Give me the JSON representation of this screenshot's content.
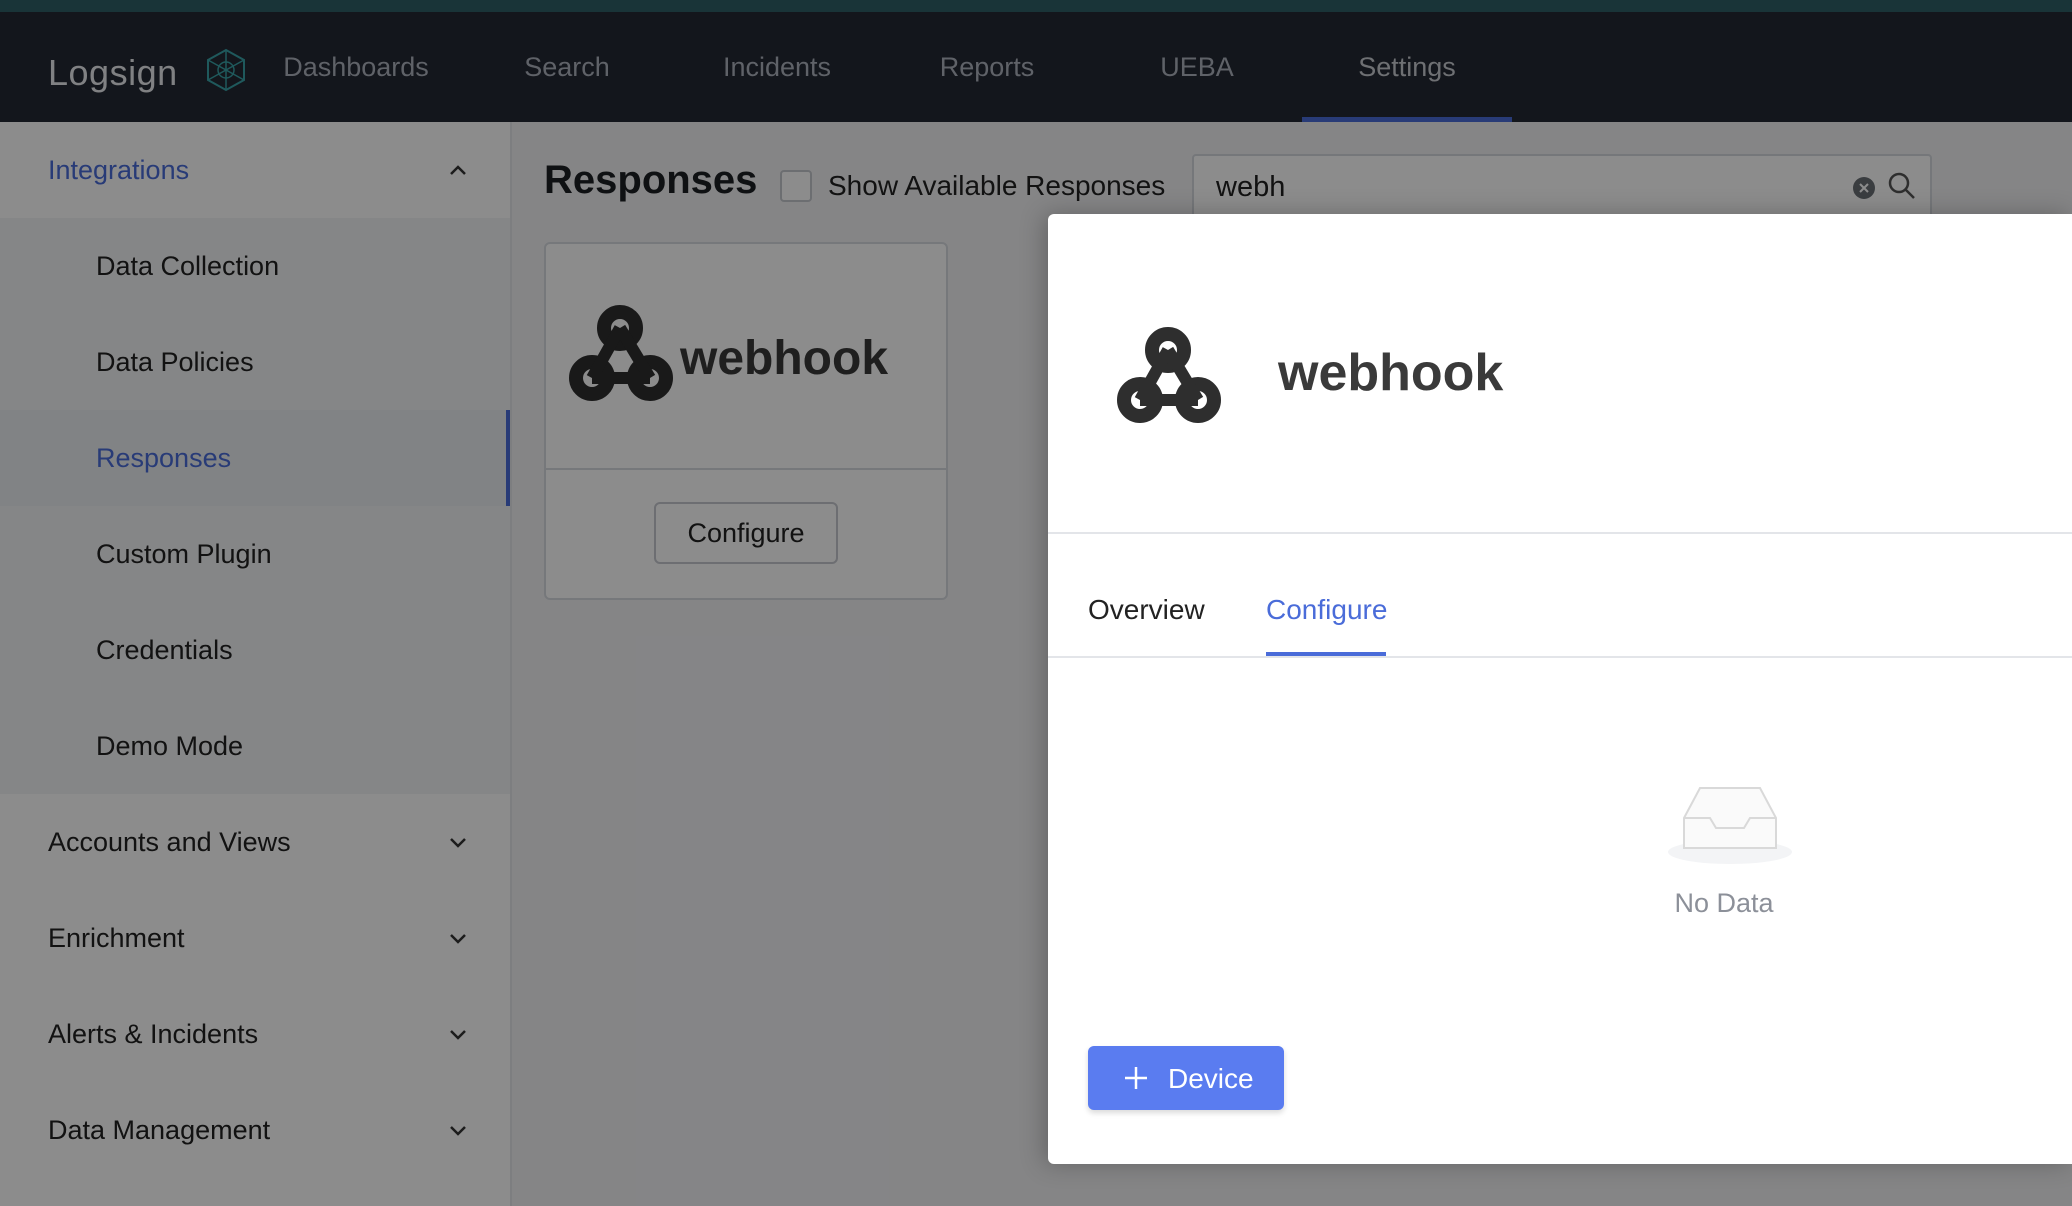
{
  "brand": {
    "logo_text": "Logsign",
    "accent": "#4a6cd9",
    "button_color": "#5a7cf0"
  },
  "nav": {
    "items": [
      {
        "label": "Dashboards"
      },
      {
        "label": "Search"
      },
      {
        "label": "Incidents"
      },
      {
        "label": "Reports"
      },
      {
        "label": "UEBA"
      },
      {
        "label": "Settings",
        "active": true
      }
    ]
  },
  "sidebar": {
    "integrations": {
      "label": "Integrations",
      "items": [
        {
          "label": "Data Collection"
        },
        {
          "label": "Data Policies"
        },
        {
          "label": "Responses",
          "active": true
        },
        {
          "label": "Custom Plugin"
        },
        {
          "label": "Credentials"
        },
        {
          "label": "Demo Mode"
        }
      ]
    },
    "groups": [
      {
        "label": "Accounts and Views"
      },
      {
        "label": "Enrichment"
      },
      {
        "label": "Alerts & Incidents"
      },
      {
        "label": "Data Management"
      }
    ]
  },
  "main": {
    "title": "Responses",
    "show_available_label": "Show Available Responses",
    "search_value": "webh",
    "card": {
      "logo_text": "webhook",
      "button_label": "Configure"
    }
  },
  "drawer": {
    "logo_text": "webhook",
    "tabs": [
      {
        "label": "Overview"
      },
      {
        "label": "Configure",
        "active": true
      }
    ],
    "empty_text": "No Data",
    "add_button_label": "Device"
  }
}
